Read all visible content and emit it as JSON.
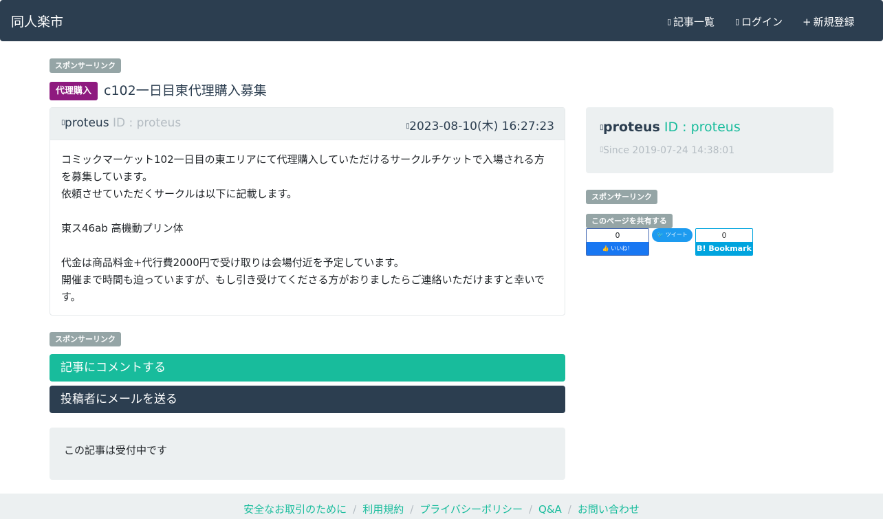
{
  "navbar": {
    "brand": "同人楽市",
    "links": [
      {
        "icon": "list-icon",
        "label": "記事一覧"
      },
      {
        "icon": "login-icon",
        "label": "ログイン"
      },
      {
        "icon": "plus-icon",
        "glyph": "+",
        "label": "新規登録"
      }
    ]
  },
  "sponsor_label": "スポンサーリンク",
  "post": {
    "category": "代理購入",
    "title": "c102一日目東代理購入募集",
    "author": "proteus",
    "author_id_text": "ID : proteus",
    "posted_at": "2023-08-10(木) 16:27:23",
    "body": [
      "コミックマーケット102一日目の東エリアにて代理購入していただけるサークルチケットで入場される方を募集しています。",
      "依頼させていただくサークルは以下に記載します。",
      "",
      "東ス46ab 高機動プリン体",
      "",
      "代金は商品料金+代行費2000円で受け取りは会場付近を予定しています。",
      "開催まで時間も迫っていますが、もし引き受けてくださる方がおりましたらご連絡いただけますと幸いです。"
    ]
  },
  "actions": {
    "comment": "記事にコメントする",
    "mail": "投稿者にメールを送る"
  },
  "status_text": "この記事は受付中です",
  "sidebar": {
    "profile_name": "proteus",
    "profile_id": "ID : proteus",
    "since": "Since 2019-07-24 14:38:01",
    "share_label": "このページを共有する",
    "fb_count": "0",
    "fb_like": "いいね！",
    "tweet": "ツイート",
    "hatena_count": "0",
    "hatena_label": "B! Bookmark"
  },
  "footer": {
    "links": [
      "安全なお取引のために",
      "利用規約",
      "プライバシーポリシー",
      "Q&A",
      "お問い合わせ"
    ]
  },
  "colors": {
    "navbar": "#2c3e50",
    "accent": "#18bc9c",
    "category": "#8e1a7f",
    "sponsor_badge": "#95a5a6",
    "panel": "#ecf0f1"
  }
}
